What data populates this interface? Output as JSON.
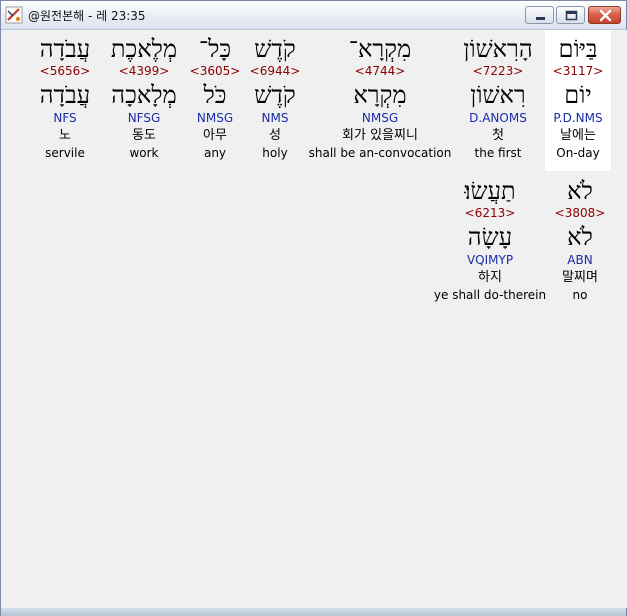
{
  "window": {
    "title": "@원전본해 - 레 23:35"
  },
  "rows": [
    {
      "words": [
        {
          "heb": "בַּיּוֹם",
          "strong": "<3117>",
          "lemma": "יוֹם",
          "gram": "P.D.NMS",
          "kor": "날에는",
          "eng": "On-day",
          "center": 576,
          "selected": true
        },
        {
          "heb": "הָרִאשׁוֹן",
          "strong": "<7223>",
          "lemma": "רִאשׁוֹן",
          "gram": "D.ANOMS",
          "kor": "첫",
          "eng": "the first",
          "center": 496
        },
        {
          "heb": "מִקְרָא־",
          "strong": "<4744>",
          "lemma": "מִקְרָא",
          "gram": "NMSG",
          "kor": "회가 있을찌니",
          "eng": "shall be an-convocation",
          "center": 378
        },
        {
          "heb": "קֹדֶשׁ",
          "strong": "<6944>",
          "lemma": "קֹדֶשׁ",
          "gram": "NMS",
          "kor": "성",
          "eng": "holy",
          "center": 273
        },
        {
          "heb": "כָּל־",
          "strong": "<3605>",
          "lemma": "כֹּל",
          "gram": "NMSG",
          "kor": "아무",
          "eng": "any",
          "center": 213
        },
        {
          "heb": "מְלֶאכֶת",
          "strong": "<4399>",
          "lemma": "מְלָאכָה",
          "gram": "NFSG",
          "kor": "동도",
          "eng": "work",
          "center": 142
        },
        {
          "heb": "עֲבֹדָה",
          "strong": "<5656>",
          "lemma": "עֲבֹדָה",
          "gram": "NFS",
          "kor": "노",
          "eng": "servile",
          "center": 63
        }
      ]
    },
    {
      "words": [
        {
          "heb": "לֹא",
          "strong": "<3808>",
          "lemma": "לֹא",
          "gram": "ABN",
          "kor": "말찌며",
          "eng": "no",
          "center": 578
        },
        {
          "heb": "תַעֲשׂוּ׃",
          "strong": "<6213>",
          "lemma": "עָשָׂה",
          "gram": "VQIMYP",
          "kor": "하지",
          "eng": "ye shall do-therein",
          "center": 488
        }
      ]
    }
  ],
  "icons": {
    "app": "app-icon",
    "minimize": "minimize-icon",
    "maximize": "maximize-icon",
    "close": "close-icon"
  }
}
